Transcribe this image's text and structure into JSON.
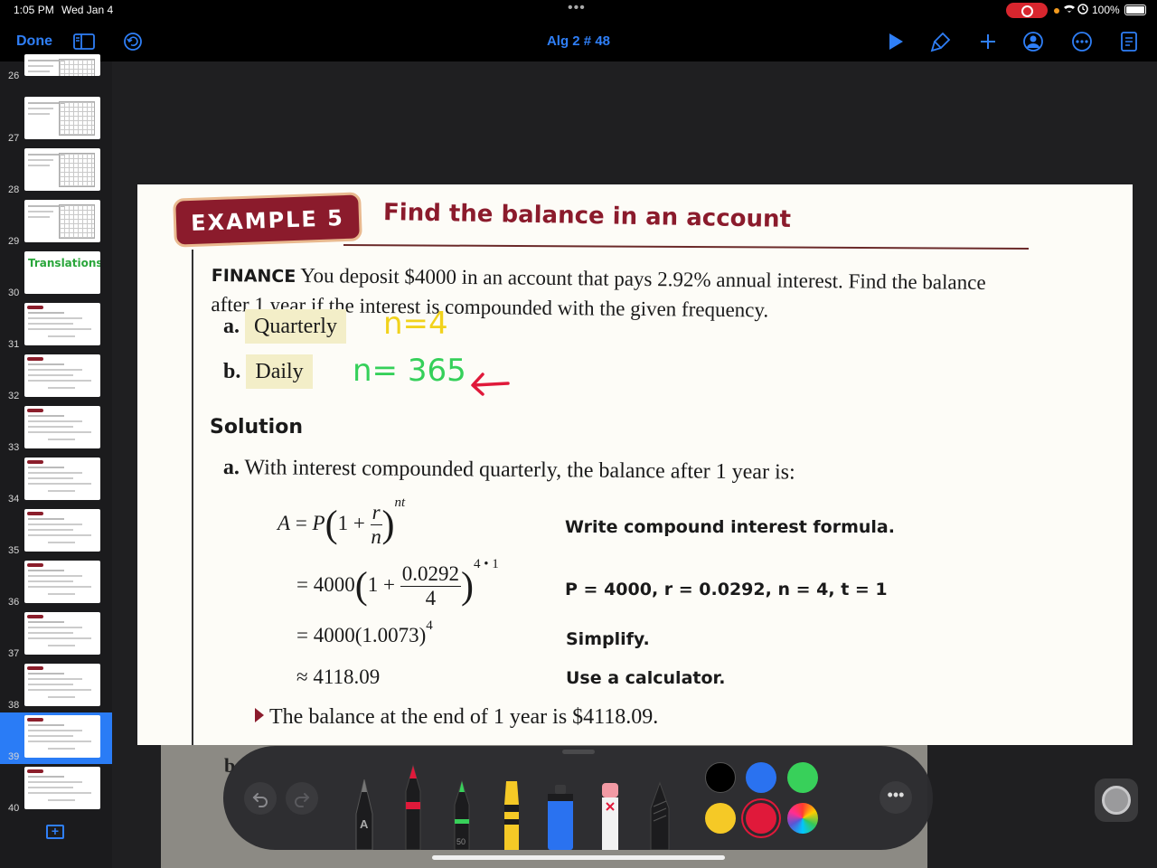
{
  "status_bar": {
    "time": "1:05 PM",
    "date": "Wed Jan 4",
    "battery": "100%",
    "multitask_dots": "•••"
  },
  "nav": {
    "done_label": "Done",
    "title": "Alg 2 # 48"
  },
  "sidebar": {
    "pages": [
      {
        "num": "26",
        "kind": "graph"
      },
      {
        "num": "27",
        "kind": "graph"
      },
      {
        "num": "28",
        "kind": "graph"
      },
      {
        "num": "29",
        "kind": "graph"
      },
      {
        "num": "30",
        "kind": "title",
        "text": "Translations"
      },
      {
        "num": "31",
        "kind": "text"
      },
      {
        "num": "32",
        "kind": "text"
      },
      {
        "num": "33",
        "kind": "text"
      },
      {
        "num": "34",
        "kind": "text"
      },
      {
        "num": "35",
        "kind": "text"
      },
      {
        "num": "36",
        "kind": "text"
      },
      {
        "num": "37",
        "kind": "text"
      },
      {
        "num": "38",
        "kind": "text"
      },
      {
        "num": "39",
        "kind": "text",
        "selected": true
      },
      {
        "num": "40",
        "kind": "text"
      }
    ],
    "add_page_icon": "plus-square-icon"
  },
  "page": {
    "example_label": "EXAMPLE 5",
    "example_title": "Find the balance in an account",
    "finance_keyword": "FINANCE",
    "problem_text": "You deposit $4000 in an account that pays 2.92% annual interest. Find the balance after 1 year if the interest is compounded with the given frequency.",
    "option_a_label": "a.",
    "option_a": "Quarterly",
    "option_b_label": "b.",
    "option_b": "Daily",
    "handwriting_a": "n=4",
    "handwriting_b": "n= 365",
    "solution_heading": "Solution",
    "solution_a_label": "a.",
    "solution_a_text": "With interest compounded quarterly, the balance after 1 year is:",
    "step1_note": "Write compound interest formula.",
    "step2_note": "P = 4000, r = 0.0292, n = 4, t = 1",
    "step3_note": "Simplify.",
    "step4_note": "Use a calculator.",
    "step2_num": "0.0292",
    "step2_den": "4",
    "step2_exp": "4 • 1",
    "step3_expr": "= 4000(1.0073)",
    "step3_exp": "4",
    "step4_expr": "≈ 4118.09",
    "answer": "The balance at the end of 1 year is $4118.09.",
    "next_part_label": "b"
  },
  "toolbar": {
    "pen_label": "A",
    "pencil_size": "50",
    "colors": [
      "#000000",
      "#2a72f0",
      "#38d05a",
      "#f5c926",
      "#e0193a",
      "rainbow"
    ],
    "selected_color": "#e0193a"
  }
}
